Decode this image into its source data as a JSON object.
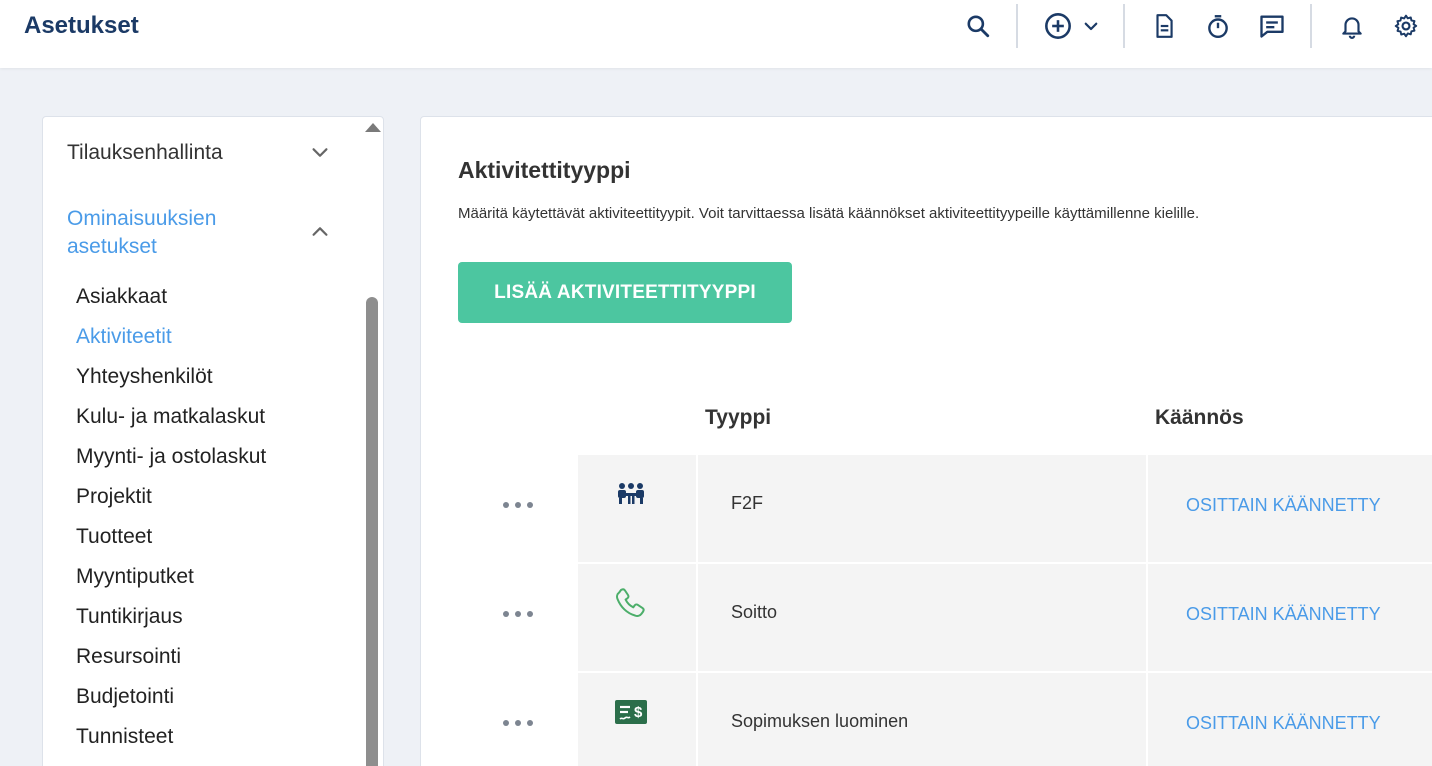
{
  "header": {
    "title": "Asetukset",
    "icons": [
      "search-icon",
      "add-circle-icon",
      "chevron-down-icon",
      "document-icon",
      "stopwatch-icon",
      "chat-icon",
      "bell-icon",
      "gear-icon"
    ]
  },
  "sidebar": {
    "sections": [
      {
        "label": "Tilauksenhallinta",
        "expanded": false
      },
      {
        "label": "Ominaisuuksien asetukset",
        "expanded": true
      }
    ],
    "items": [
      {
        "label": "Asiakkaat",
        "active": false
      },
      {
        "label": "Aktiviteetit",
        "active": true
      },
      {
        "label": "Yhteyshenkilöt",
        "active": false
      },
      {
        "label": "Kulu- ja matkalaskut",
        "active": false
      },
      {
        "label": "Myynti- ja ostolaskut",
        "active": false
      },
      {
        "label": "Projektit",
        "active": false
      },
      {
        "label": "Tuotteet",
        "active": false
      },
      {
        "label": "Myyntiputket",
        "active": false
      },
      {
        "label": "Tuntikirjaus",
        "active": false
      },
      {
        "label": "Resursointi",
        "active": false
      },
      {
        "label": "Budjetointi",
        "active": false
      },
      {
        "label": "Tunnisteet",
        "active": false
      }
    ]
  },
  "main": {
    "title": "Aktivitettityyppi",
    "description": "Määritä käytettävät aktiviteettityypit. Voit tarvittaessa lisätä käännökset aktiviteettityypeille käyttämillenne kielille.",
    "add_button": "LISÄÄ AKTIVITEETTITYYPPI",
    "table": {
      "columns": [
        "Tyyppi",
        "Käännös"
      ],
      "rows": [
        {
          "icon": "meeting-icon",
          "type": "F2F",
          "translation": "OSITTAIN KÄÄNNETTY"
        },
        {
          "icon": "phone-icon",
          "type": "Soitto",
          "translation": "OSITTAIN KÄÄNNETTY"
        },
        {
          "icon": "contract-icon",
          "type": "Sopimuksen luominen",
          "translation": "OSITTAIN KÄÄNNETTY"
        }
      ]
    }
  },
  "colors": {
    "brand": "#1b3a66",
    "accent": "#4a9be8",
    "button": "#4cc6a0",
    "phone_icon": "#4cae6a",
    "contract_icon": "#2b6e4a"
  }
}
